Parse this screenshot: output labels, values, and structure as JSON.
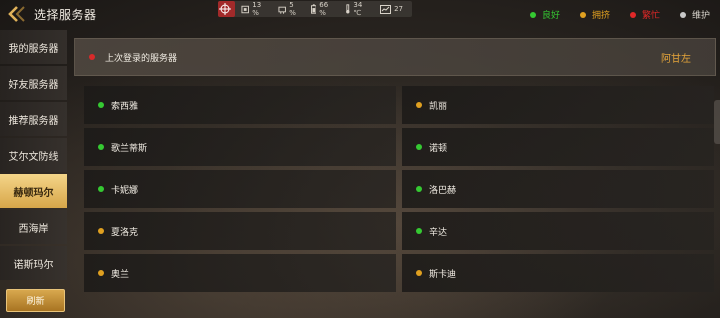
{
  "header": {
    "title": "选择服务器"
  },
  "status_strip": {
    "cpu": "13 %",
    "memory": "5 %",
    "battery": "66 %",
    "temperature": "34 ℃",
    "fps": "27"
  },
  "legend": [
    {
      "label": "良好",
      "color": "#35c932"
    },
    {
      "label": "拥挤",
      "color": "#e0a020"
    },
    {
      "label": "繁忙",
      "color": "#e02828"
    },
    {
      "label": "维护",
      "color": "#c8c8c8"
    }
  ],
  "sidebar": {
    "items": [
      {
        "label": "我的服务器",
        "active": false
      },
      {
        "label": "好友服务器",
        "active": false
      },
      {
        "label": "推荐服务器",
        "active": false
      },
      {
        "label": "艾尔文防线",
        "active": false
      },
      {
        "label": "赫顿玛尔",
        "active": true
      },
      {
        "label": "西海岸",
        "active": false
      },
      {
        "label": "诺斯玛尔",
        "active": false
      }
    ],
    "refresh_label": "刷新"
  },
  "last_login": {
    "label": "上次登录的服务器",
    "server": "阿甘左",
    "status_color": "#d82a2a"
  },
  "servers": [
    {
      "name": "索西雅",
      "status_color": "#35c932"
    },
    {
      "name": "凯丽",
      "status_color": "#e0a020"
    },
    {
      "name": "歌兰蒂斯",
      "status_color": "#35c932"
    },
    {
      "name": "诺顿",
      "status_color": "#35c932"
    },
    {
      "name": "卡妮娜",
      "status_color": "#35c932"
    },
    {
      "name": "洛巴赫",
      "status_color": "#35c932"
    },
    {
      "name": "夏洛克",
      "status_color": "#e0a020"
    },
    {
      "name": "辛达",
      "status_color": "#35c932"
    },
    {
      "name": "奥兰",
      "status_color": "#e0a020"
    },
    {
      "name": "斯卡迪",
      "status_color": "#e0a020"
    }
  ]
}
